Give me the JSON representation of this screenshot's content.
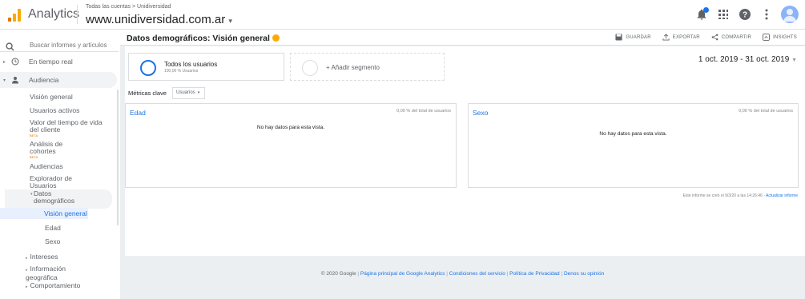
{
  "header": {
    "app_name": "Analytics",
    "account_path": "Todas las cuentas > Unidiversidad",
    "property": "www.unidiversidad.com.ar",
    "icons": [
      "notifications-icon",
      "apps-icon",
      "help-icon",
      "more-vert-icon",
      "account-avatar"
    ]
  },
  "sidebar": {
    "search_placeholder": "Buscar informes y artículos",
    "realtime_label": "En tiempo real",
    "audiencia_label": "Audiencia",
    "items": [
      {
        "label": "Visión general"
      },
      {
        "label": "Usuarios activos"
      },
      {
        "label": "Valor del tiempo de vida del cliente",
        "badge": "BETA"
      },
      {
        "label": "Análisis de cohortes",
        "badge": "BETA"
      },
      {
        "label": "Audiencias"
      },
      {
        "label": "Explorador de Usuarios"
      }
    ],
    "demographics": {
      "label": "Datos demográficos",
      "children": [
        "Visión general",
        "Edad",
        "Sexo"
      ]
    },
    "more": [
      "Intereses",
      "Información geográfica",
      "Comportamiento"
    ]
  },
  "main": {
    "title": "Datos demográficos: Visión general",
    "actions": [
      "GUARDAR",
      "EXPORTAR",
      "COMPARTIR",
      "INSIGHTS"
    ],
    "segments": {
      "active_title": "Todos los usuarios",
      "active_sub": "100,00 % Usuarios",
      "add_label": "+ Añadir segmento"
    },
    "date_range": "1 oct. 2019 - 31 oct. 2019",
    "metrics": {
      "label": "Métricas clave",
      "selected": "Usuarios"
    },
    "panels": [
      {
        "title": "Edad",
        "pct": "0,00 % del total de usuarios",
        "nodata": "No hay datos para esta vista."
      },
      {
        "title": "Sexo",
        "pct": "0,00 % del total de usuarios",
        "nodata": "No hay datos para esta vista."
      }
    ],
    "report_note": "Este informe se creó el 9/3/20 a las 14:26:46 - ",
    "report_link": "Actualizar informe"
  },
  "footer": {
    "copyright": "© 2020 Google",
    "links": [
      "Página principal de Google Analytics",
      "Condiciones del servicio",
      "Política de Privacidad",
      "Denos su opinión"
    ]
  },
  "colors": {
    "accent": "#1a73e8",
    "logo_orange": "#e37400",
    "logo_yellow": "#f9ab00"
  }
}
